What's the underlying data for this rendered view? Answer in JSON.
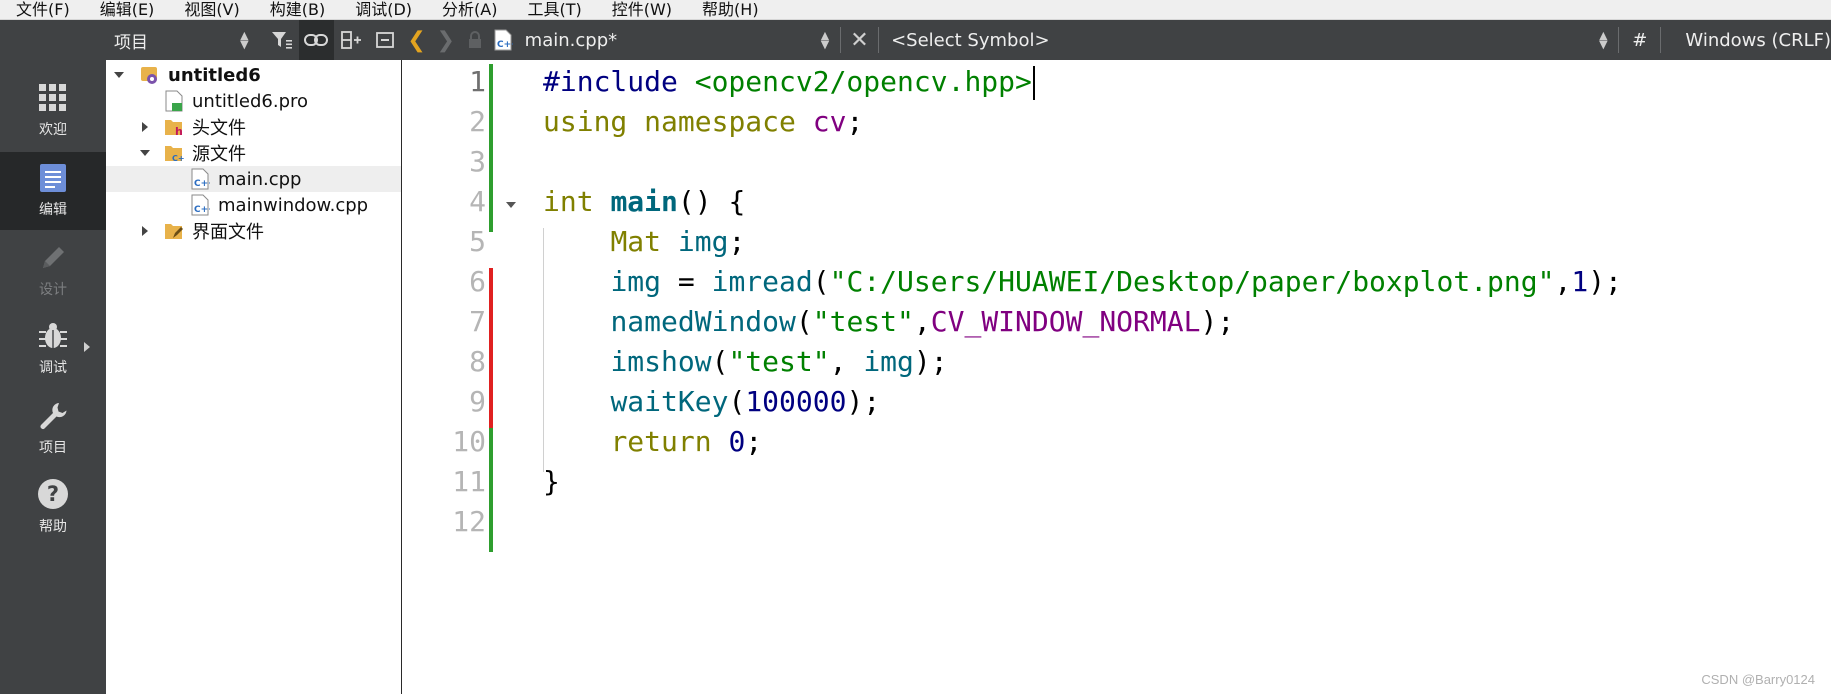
{
  "menu": [
    "文件(F)",
    "编辑(E)",
    "视图(V)",
    "构建(B)",
    "调试(D)",
    "分析(A)",
    "工具(T)",
    "控件(W)",
    "帮助(H)"
  ],
  "modes": [
    {
      "label": "欢迎",
      "icon": "grid-icon",
      "state": "normal"
    },
    {
      "label": "编辑",
      "icon": "document-icon",
      "state": "active"
    },
    {
      "label": "设计",
      "icon": "pencil-icon",
      "state": "disabled"
    },
    {
      "label": "调试",
      "icon": "bug-icon",
      "state": "normal"
    },
    {
      "label": "项目",
      "icon": "wrench-icon",
      "state": "normal"
    },
    {
      "label": "帮助",
      "icon": "help-icon",
      "state": "normal"
    }
  ],
  "project_pane": {
    "title": "项目",
    "tree": [
      {
        "label": "untitled6",
        "bold": true,
        "expanded": true,
        "icon": "project-icon"
      },
      {
        "label": "untitled6.pro",
        "icon": "pro-file-icon"
      },
      {
        "label": "头文件",
        "expanded": false,
        "icon": "header-folder-icon"
      },
      {
        "label": "源文件",
        "expanded": true,
        "icon": "source-folder-icon"
      },
      {
        "label": "main.cpp",
        "selected": true,
        "icon": "cpp-file-icon"
      },
      {
        "label": "mainwindow.cpp",
        "icon": "cpp-file-icon"
      },
      {
        "label": "界面文件",
        "expanded": false,
        "icon": "forms-folder-icon"
      }
    ]
  },
  "editor": {
    "document": "main.cpp*",
    "symbol_placeholder": "<Select Symbol>",
    "hash": "#",
    "line_ending": "Windows (CRLF)",
    "current_line": 1,
    "line_numbers": [
      "1",
      "2",
      "3",
      "4",
      "5",
      "6",
      "7",
      "8",
      "9",
      "10",
      "11",
      "12"
    ],
    "code": [
      [
        [
          "pp",
          "#include "
        ],
        [
          "str",
          "<opencv2/opencv.hpp>"
        ]
      ],
      [
        [
          "kw",
          "using"
        ],
        [
          "txt",
          " "
        ],
        [
          "kw",
          "namespace"
        ],
        [
          "txt",
          " "
        ],
        [
          "ns",
          "cv"
        ],
        [
          "txt",
          ";"
        ]
      ],
      [],
      [
        [
          "kw",
          "int"
        ],
        [
          "txt",
          " "
        ],
        [
          "main",
          "main"
        ],
        [
          "txt",
          "() {"
        ]
      ],
      [
        [
          "txt",
          "    "
        ],
        [
          "kw",
          "Mat"
        ],
        [
          "txt",
          " "
        ],
        [
          "fn",
          "img"
        ],
        [
          "txt",
          ";"
        ]
      ],
      [
        [
          "txt",
          "    "
        ],
        [
          "fn",
          "img"
        ],
        [
          "txt",
          " = "
        ],
        [
          "fn",
          "imread"
        ],
        [
          "txt",
          "("
        ],
        [
          "str",
          "\"C:/Users/HUAWEI/Desktop/paper/boxplot.png\""
        ],
        [
          "txt",
          ","
        ],
        [
          "num",
          "1"
        ],
        [
          "txt",
          ");"
        ]
      ],
      [
        [
          "txt",
          "    "
        ],
        [
          "fn",
          "namedWindow"
        ],
        [
          "txt",
          "("
        ],
        [
          "str",
          "\"test\""
        ],
        [
          "txt",
          ","
        ],
        [
          "mac",
          "CV_WINDOW_NORMAL"
        ],
        [
          "txt",
          ");"
        ]
      ],
      [
        [
          "txt",
          "    "
        ],
        [
          "fn",
          "imshow"
        ],
        [
          "txt",
          "("
        ],
        [
          "str",
          "\"test\""
        ],
        [
          "txt",
          ", "
        ],
        [
          "fn",
          "img"
        ],
        [
          "txt",
          ");"
        ]
      ],
      [
        [
          "txt",
          "    "
        ],
        [
          "fn",
          "waitKey"
        ],
        [
          "txt",
          "("
        ],
        [
          "num",
          "100000"
        ],
        [
          "txt",
          ");"
        ]
      ],
      [
        [
          "txt",
          "    "
        ],
        [
          "kw",
          "return"
        ],
        [
          "txt",
          " "
        ],
        [
          "num",
          "0"
        ],
        [
          "txt",
          ";"
        ]
      ],
      [
        [
          "txt",
          "}"
        ]
      ],
      []
    ],
    "change_markers": [
      {
        "from_line": 1,
        "to_line": 5,
        "color": "#2e9e2e"
      },
      {
        "from_line": 6,
        "to_line": 9,
        "color": "#e02020"
      },
      {
        "from_line": 10,
        "to_line": 12,
        "color": "#2e9e2e"
      }
    ]
  },
  "watermark": "CSDN @Barry0124"
}
